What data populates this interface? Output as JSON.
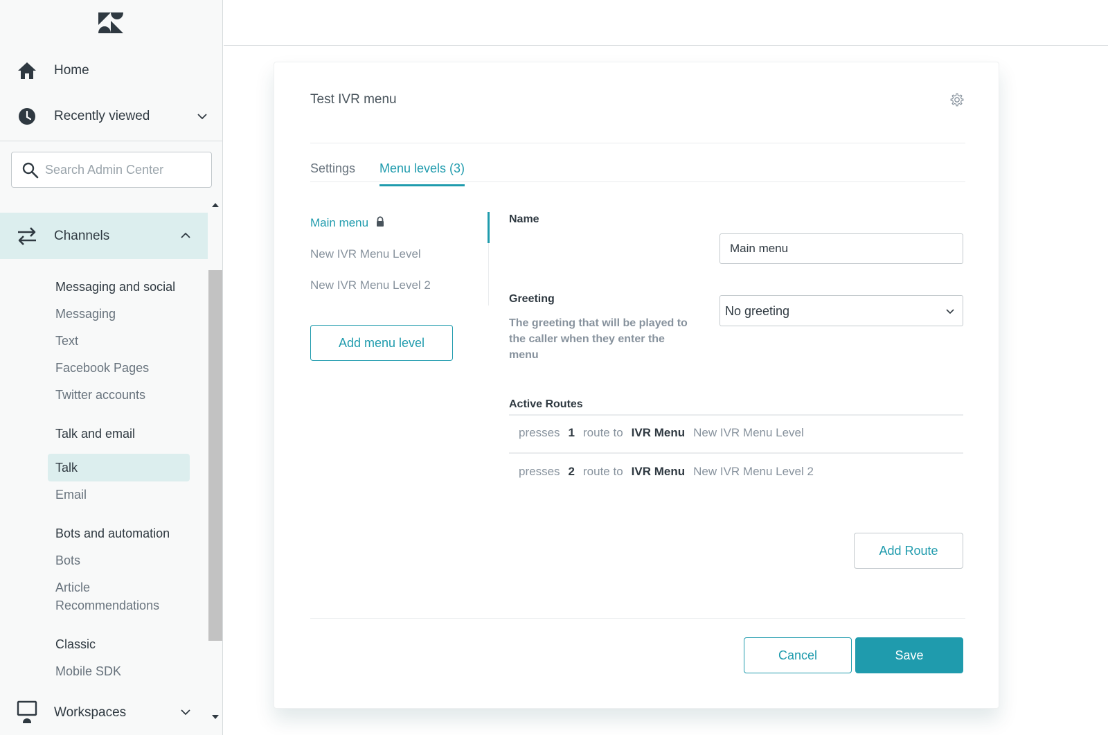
{
  "colors": {
    "accent": "#1f9bad",
    "active_bg": "#dceeee",
    "text": "#2f3941",
    "muted": "#87929d"
  },
  "sidebar": {
    "logo": "zendesk-logo",
    "home": {
      "label": "Home",
      "icon": "home-icon"
    },
    "recently_viewed": {
      "label": "Recently viewed",
      "icon": "clock-icon"
    },
    "search": {
      "placeholder": "Search Admin Center",
      "value": ""
    },
    "channels": {
      "label": "Channels",
      "icon": "arrows-swap-icon",
      "expanded": true
    },
    "groups": [
      {
        "title": "Messaging and social",
        "items": [
          "Messaging",
          "Text",
          "Facebook Pages",
          "Twitter accounts"
        ]
      },
      {
        "title": "Talk and email",
        "items": [
          "Talk",
          "Email"
        ],
        "active": "Talk"
      },
      {
        "title": "Bots and automation",
        "items": [
          "Bots",
          "Article",
          "Recommendations"
        ]
      },
      {
        "title": "Classic",
        "items": [
          "Mobile SDK"
        ]
      }
    ],
    "workspaces": {
      "label": "Workspaces",
      "icon": "monitor-icon"
    }
  },
  "modal": {
    "title": "Test IVR menu",
    "tabs": [
      {
        "label": "Settings",
        "active": false
      },
      {
        "label": "Menu levels (3)",
        "active": true
      }
    ],
    "levels": [
      {
        "label": "Main menu",
        "locked": true,
        "active": true
      },
      {
        "label": "New IVR Menu Level",
        "locked": false,
        "active": false
      },
      {
        "label": "New IVR Menu Level 2",
        "locked": false,
        "active": false
      }
    ],
    "add_level_label": "Add menu level",
    "name_label": "Name",
    "name_value": "Main menu",
    "greeting_label": "Greeting",
    "greeting_hint": "The greeting that will be played to the caller when they enter the menu",
    "greeting_value": "No greeting",
    "routes_title": "Active Routes",
    "routes": [
      {
        "presses_text": "presses",
        "key": "1",
        "route_text": "route to",
        "type": "IVR Menu",
        "target": "New IVR Menu Level"
      },
      {
        "presses_text": "presses",
        "key": "2",
        "route_text": "route to",
        "type": "IVR Menu",
        "target": "New IVR Menu Level 2"
      }
    ],
    "add_route_label": "Add Route",
    "cancel_label": "Cancel",
    "save_label": "Save"
  }
}
